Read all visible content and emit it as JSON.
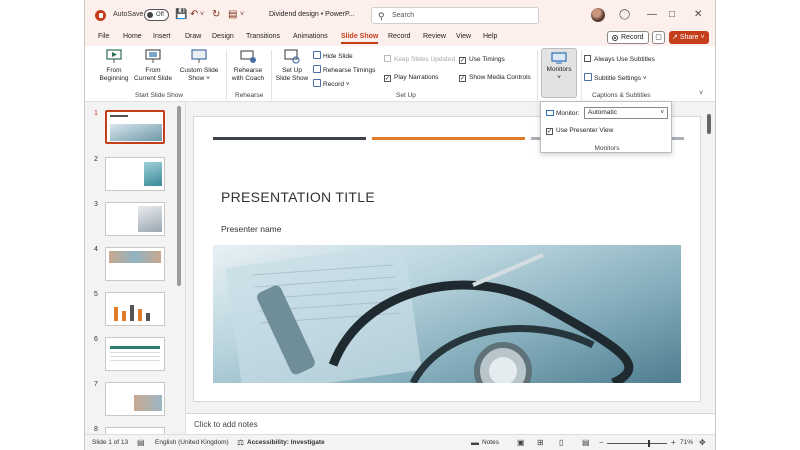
{
  "titlebar": {
    "autosave_label": "AutoSave",
    "autosave_state": "Off",
    "doc_title": "Dividend design • PowerP...",
    "search_placeholder": "Search"
  },
  "menu": {
    "items": [
      "File",
      "Home",
      "Insert",
      "Draw",
      "Design",
      "Transitions",
      "Animations",
      "Slide Show",
      "Record",
      "Review",
      "View",
      "Help"
    ],
    "active": "Slide Show",
    "record_button": "Record",
    "share_button": "Share"
  },
  "ribbon": {
    "from_beginning": [
      "From",
      "Beginning"
    ],
    "from_current": [
      "From",
      "Current Slide"
    ],
    "custom_show": [
      "Custom Slide",
      "Show ˅"
    ],
    "group_start": "Start Slide Show",
    "rehearse_coach": [
      "Rehearse",
      "with Coach"
    ],
    "group_rehearse": "Rehearse",
    "set_up": [
      "Set Up",
      "Slide Show"
    ],
    "hide_slide": "Hide Slide",
    "rehearse_timings": "Rehearse Timings",
    "record": "Record ˅",
    "keep_updated": "Keep Slides Updated",
    "play_narrations": "Play Narrations",
    "use_timings": "Use Timings",
    "show_media": "Show Media Controls",
    "group_setup": "Set Up",
    "monitors": "Monitors",
    "always_subtitles": "Always Use Subtitles",
    "subtitle_settings": "Subtitle Settings ˅",
    "group_captions": "Captions & Subtitles",
    "checks": {
      "play_narrations": true,
      "use_timings": true,
      "show_media": true,
      "keep_updated": false,
      "always_subtitles": false
    }
  },
  "monitor_panel": {
    "label": "Monitor:",
    "selected": "Automatic",
    "presenter_view": "Use Presenter View",
    "presenter_view_checked": true,
    "group_label": "Monitors"
  },
  "thumbnails": {
    "numbers": [
      "1",
      "2",
      "3",
      "4",
      "5",
      "6",
      "7",
      "8"
    ],
    "active_index": 0
  },
  "slide": {
    "title": "PRESENTATION TITLE",
    "presenter": "Presenter name",
    "line_colors": [
      "#3d4349",
      "#e07b2a",
      "#a9b0b7"
    ]
  },
  "notes": {
    "placeholder": "Click to add notes"
  },
  "status": {
    "slide_count": "Slide 1 of 13",
    "language": "English (United Kingdom)",
    "accessibility": "Accessibility: Investigate",
    "notes": "Notes",
    "zoom": "71%",
    "zoom_level": 0.71
  },
  "colors": {
    "accent": "#c43e1c",
    "titlebar_bg": "#fdf0ec"
  }
}
